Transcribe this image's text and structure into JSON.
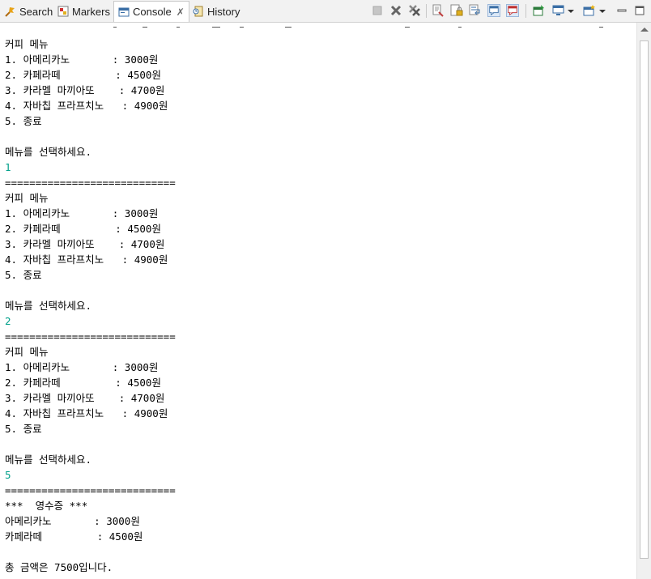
{
  "tabs": [
    {
      "label": "Search"
    },
    {
      "label": "Markers"
    },
    {
      "label": "Console"
    },
    {
      "label": "History"
    }
  ],
  "console_tab_close": "✗",
  "toolbar_icons": [
    "terminate-icon",
    "remove-launch-icon",
    "remove-all-launches-icon",
    "clear-console-icon",
    "scroll-lock-icon",
    "word-wrap-icon",
    "show-on-stdout-icon",
    "show-on-stderr-icon",
    "pin-console-icon",
    "display-console-icon",
    "dropdown-arrow-icon",
    "new-console-icon",
    "dropdown-arrow-icon",
    "minimize-icon",
    "maximize-icon"
  ],
  "colors": {
    "stdout": "#000000",
    "stdin": "#00a08a",
    "tab_background": "#f2f2f2",
    "pressed_button": "#dbe8f7"
  },
  "console": {
    "lines": [
      {
        "text": "커피 메뉴",
        "type": "out"
      },
      {
        "text": "1. 아메리카노       : 3000원",
        "type": "out"
      },
      {
        "text": "2. 카페라떼         : 4500원",
        "type": "out"
      },
      {
        "text": "3. 카라멜 마끼아또    : 4700원",
        "type": "out"
      },
      {
        "text": "4. 자바칩 프라프치노   : 4900원",
        "type": "out"
      },
      {
        "text": "5. 종료",
        "type": "out"
      },
      {
        "text": "",
        "type": "out"
      },
      {
        "text": "메뉴를 선택하세요.",
        "type": "out"
      },
      {
        "text": "1",
        "type": "in"
      },
      {
        "text": "============================",
        "type": "out"
      },
      {
        "text": "커피 메뉴",
        "type": "out"
      },
      {
        "text": "1. 아메리카노       : 3000원",
        "type": "out"
      },
      {
        "text": "2. 카페라떼         : 4500원",
        "type": "out"
      },
      {
        "text": "3. 카라멜 마끼아또    : 4700원",
        "type": "out"
      },
      {
        "text": "4. 자바칩 프라프치노   : 4900원",
        "type": "out"
      },
      {
        "text": "5. 종료",
        "type": "out"
      },
      {
        "text": "",
        "type": "out"
      },
      {
        "text": "메뉴를 선택하세요.",
        "type": "out"
      },
      {
        "text": "2",
        "type": "in"
      },
      {
        "text": "============================",
        "type": "out"
      },
      {
        "text": "커피 메뉴",
        "type": "out"
      },
      {
        "text": "1. 아메리카노       : 3000원",
        "type": "out"
      },
      {
        "text": "2. 카페라떼         : 4500원",
        "type": "out"
      },
      {
        "text": "3. 카라멜 마끼아또    : 4700원",
        "type": "out"
      },
      {
        "text": "4. 자바칩 프라프치노   : 4900원",
        "type": "out"
      },
      {
        "text": "5. 종료",
        "type": "out"
      },
      {
        "text": "",
        "type": "out"
      },
      {
        "text": "메뉴를 선택하세요.",
        "type": "out"
      },
      {
        "text": "5",
        "type": "in"
      },
      {
        "text": "============================",
        "type": "out"
      },
      {
        "text": "***  영수증 ***",
        "type": "out"
      },
      {
        "text": "아메리카노       : 3000원",
        "type": "out"
      },
      {
        "text": "카페라떼         : 4500원",
        "type": "out"
      },
      {
        "text": "",
        "type": "out"
      },
      {
        "text": "총 금액은 7500입니다.",
        "type": "out"
      }
    ]
  }
}
